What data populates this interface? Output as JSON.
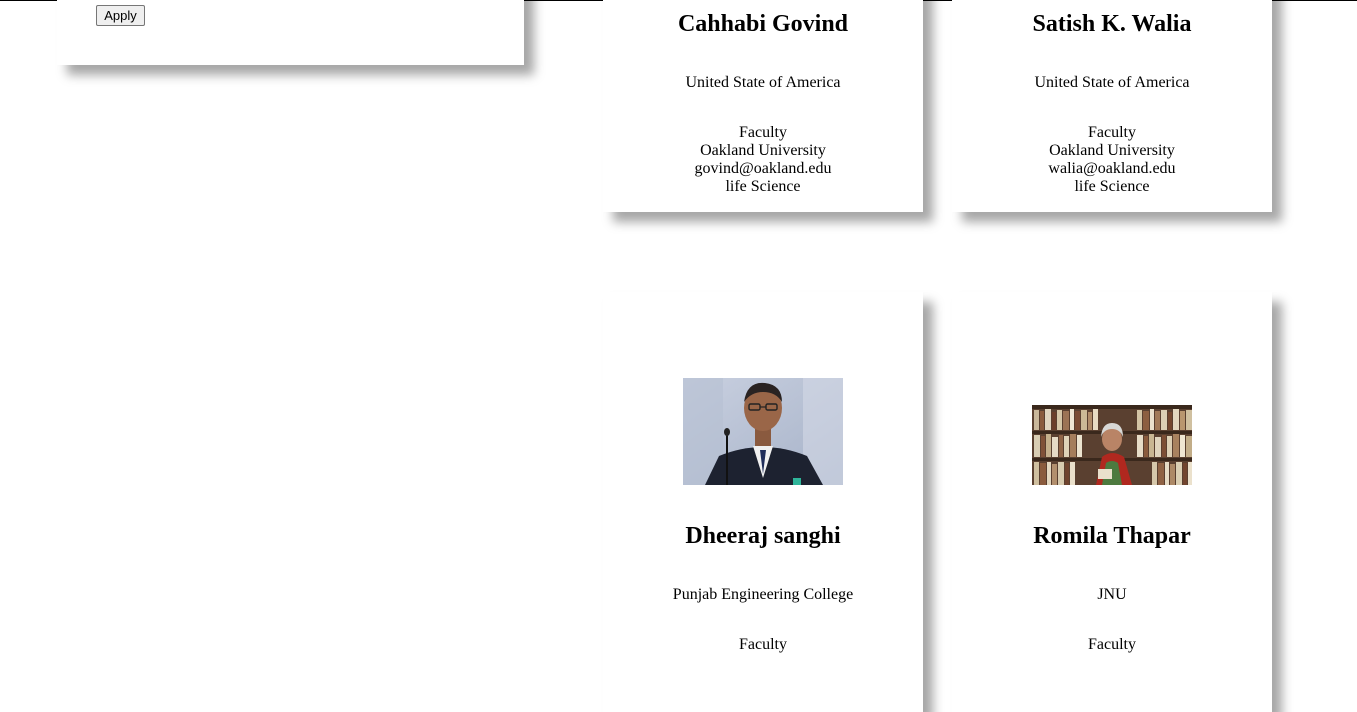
{
  "filter": {
    "apply_label": "Apply"
  },
  "cards": [
    {
      "name": "Cahhabi Govind",
      "org": "United State of America",
      "role": "Faculty",
      "institution": "Oakland University",
      "email": "govind@oakland.edu",
      "field": "life Science"
    },
    {
      "name": "Satish K. Walia",
      "org": "United State of America",
      "role": "Faculty",
      "institution": "Oakland University",
      "email": "walia@oakland.edu",
      "field": "life Science"
    },
    {
      "name": "Dheeraj sanghi",
      "org": "Punjab Engineering College",
      "role": "Faculty",
      "photo": "portrait of man in suit speaking at microphone"
    },
    {
      "name": "Romila Thapar",
      "org": "JNU",
      "role": "Faculty",
      "photo": "portrait of woman in front of bookshelves"
    }
  ]
}
